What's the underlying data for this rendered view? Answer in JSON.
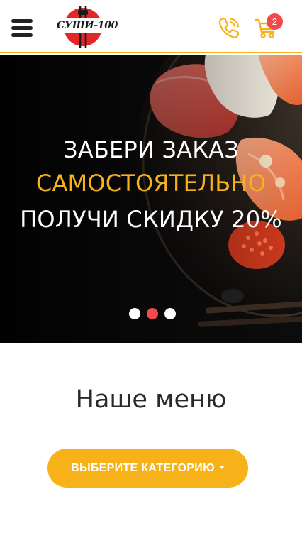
{
  "header": {
    "logo_text": "СУШИ-100",
    "cart_count": "2",
    "colors": {
      "accent": "#f7b21a",
      "badge": "#f24a4a"
    }
  },
  "hero": {
    "line1": "ЗАБЕРИ ЗАКАЗ",
    "line2": "САМОСТОЯТЕЛЬНО",
    "line3": "ПОЛУЧИ СКИДКУ 20%",
    "slides_total": 3,
    "active_slide": 2
  },
  "menu": {
    "title": "Наше меню",
    "category_button": "ВЫБЕРИТЕ КАТЕГОРИЮ"
  },
  "icons": [
    "hamburger-menu-icon",
    "phone-icon",
    "cart-icon",
    "chevron-down-icon"
  ]
}
